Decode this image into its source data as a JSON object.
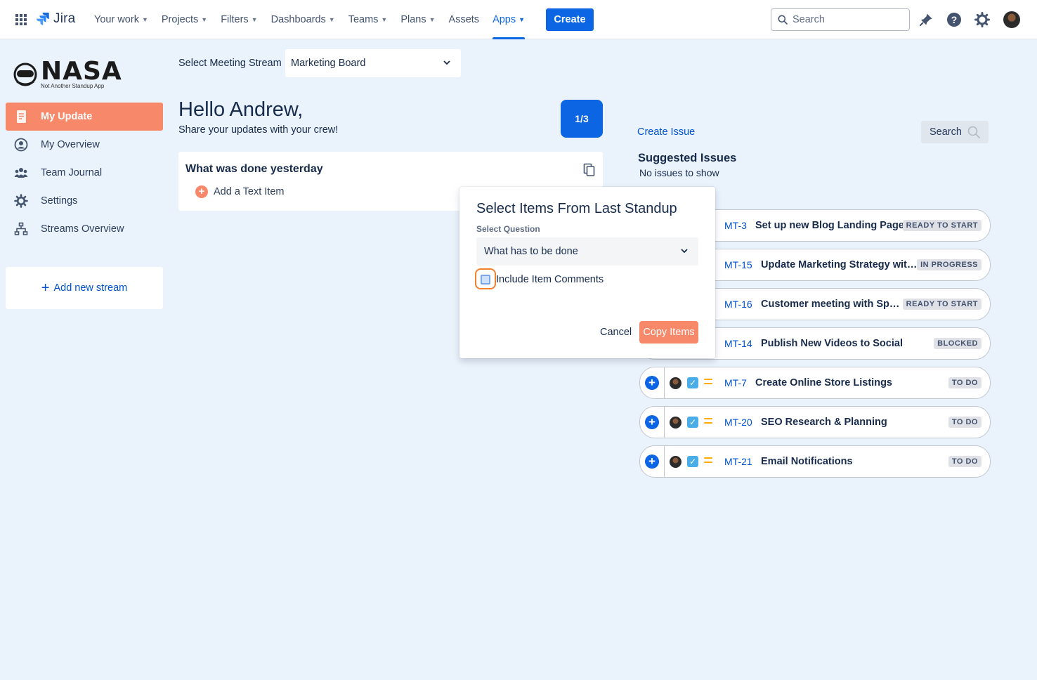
{
  "topnav": {
    "logo_text": "Jira",
    "items": [
      {
        "label": "Your work",
        "has_chevron": true
      },
      {
        "label": "Projects",
        "has_chevron": true
      },
      {
        "label": "Filters",
        "has_chevron": true
      },
      {
        "label": "Dashboards",
        "has_chevron": true
      },
      {
        "label": "Teams",
        "has_chevron": true
      },
      {
        "label": "Plans",
        "has_chevron": true
      },
      {
        "label": "Assets",
        "has_chevron": false
      },
      {
        "label": "Apps",
        "has_chevron": true,
        "active": true
      }
    ],
    "create_label": "Create",
    "search_placeholder": "Search",
    "icons": [
      "notification-icon",
      "help-icon",
      "settings-icon",
      "profile-avatar"
    ],
    "accent_color": "#0c66e4"
  },
  "sidebar": {
    "brand": "NASA",
    "brand_sub": "Not Another Standup App",
    "items": [
      {
        "label": "My Update",
        "icon": "document-icon",
        "active": true
      },
      {
        "label": "My Overview",
        "icon": "user-circle-icon"
      },
      {
        "label": "Team Journal",
        "icon": "people-icon"
      },
      {
        "label": "Settings",
        "icon": "gear-icon"
      },
      {
        "label": "Streams Overview",
        "icon": "hierarchy-icon"
      }
    ],
    "add_stream_label": "Add new stream",
    "active_color": "#f8886a"
  },
  "main": {
    "stream_label": "Select Meeting Stream",
    "stream_value": "Marketing Board",
    "greeting": "Hello Andrew,",
    "subtitle": "Share your updates with your crew!",
    "progress": "1/3",
    "card": {
      "title": "What was done yesterday",
      "add_text_item": "Add a Text Item"
    }
  },
  "right_panel": {
    "create_issue": "Create Issue",
    "search_label": "Search",
    "suggested_title": "Suggested Issues",
    "no_issues": "No issues to show",
    "issues": [
      {
        "key": "MT-3",
        "summary": "Set up new Blog Landing Page",
        "status": "READY TO START"
      },
      {
        "key": "MT-15",
        "summary": "Update Marketing Strategy wit…",
        "status": "IN PROGRESS"
      },
      {
        "key": "MT-16",
        "summary": "Customer meeting with Sp…",
        "status": "READY TO START"
      },
      {
        "key": "MT-14",
        "summary": "Publish New Videos to Social",
        "status": "BLOCKED"
      },
      {
        "key": "MT-7",
        "summary": "Create Online Store Listings",
        "status": "TO DO"
      },
      {
        "key": "MT-20",
        "summary": "SEO Research & Planning",
        "status": "TO DO"
      },
      {
        "key": "MT-21",
        "summary": "Email Notifications",
        "status": "TO DO"
      }
    ]
  },
  "modal": {
    "title": "Select Items From Last Standup",
    "question_label": "Select Question",
    "question_value": "What has to be done",
    "include_comments_label": "Include Item Comments",
    "include_comments_checked": false,
    "cancel_label": "Cancel",
    "copy_label": "Copy Items"
  }
}
